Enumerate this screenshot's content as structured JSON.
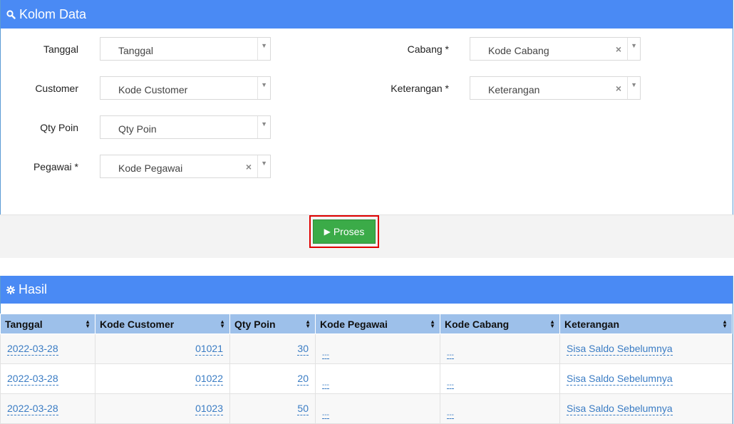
{
  "panel1": {
    "title": "Kolom Data",
    "icon": "search-icon"
  },
  "form": {
    "tanggal": {
      "label": "Tanggal",
      "placeholder": "Tanggal"
    },
    "customer": {
      "label": "Customer",
      "placeholder": "Kode Customer"
    },
    "qty": {
      "label": "Qty Poin",
      "placeholder": "Qty Poin"
    },
    "pegawai": {
      "label": "Pegawai *",
      "placeholder": "Kode Pegawai"
    },
    "cabang": {
      "label": "Cabang *",
      "placeholder": "Kode Cabang"
    },
    "keterangan": {
      "label": "Keterangan *",
      "placeholder": "Keterangan"
    }
  },
  "proses_label": "Proses",
  "panel2": {
    "title": "Hasil",
    "icon": "gear-icon"
  },
  "table": {
    "headers": [
      "Tanggal",
      "Kode Customer",
      "Qty Poin",
      "Kode Pegawai",
      "Kode Cabang",
      "Keterangan"
    ],
    "rows": [
      [
        "2022-03-28",
        "01021",
        "30",
        "---",
        "---",
        "Sisa Saldo Sebelumnya"
      ],
      [
        "2022-03-28",
        "01022",
        "20",
        "---",
        "---",
        "Sisa Saldo Sebelumnya"
      ],
      [
        "2022-03-28",
        "01023",
        "50",
        "---",
        "---",
        "Sisa Saldo Sebelumnya"
      ]
    ]
  },
  "colors": {
    "header_blue": "#4a8af4",
    "table_header": "#9dc0ea",
    "button_green": "#3bab48",
    "highlight_red": "#e00000",
    "link_blue": "#3a7cc4"
  }
}
